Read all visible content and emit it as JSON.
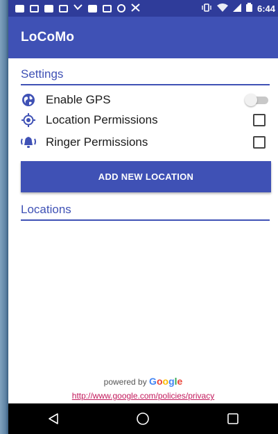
{
  "status_bar": {
    "time": "6:44",
    "notification_icons": [
      "message-icon",
      "list-icon",
      "card-icon",
      "gmail-icon",
      "missed-call-icon",
      "image-icon",
      "gallery-icon",
      "whatsapp-icon",
      "tools-icon"
    ],
    "system_icons": [
      "vibrate-icon",
      "wifi-icon",
      "signal-icon",
      "battery-icon"
    ]
  },
  "app_bar": {
    "title": "LoCoMo",
    "color": "#3f51b5"
  },
  "settings": {
    "header": "Settings",
    "items": [
      {
        "label": "Enable GPS",
        "icon": "globe-icon",
        "control": "toggle",
        "value": false
      },
      {
        "label": "Location Permissions",
        "icon": "location-target-icon",
        "control": "checkbox",
        "value": false
      },
      {
        "label": "Ringer Permissions",
        "icon": "ringer-icon",
        "control": "checkbox",
        "value": false
      }
    ]
  },
  "add_button": {
    "label": "ADD NEW LOCATION"
  },
  "locations": {
    "header": "Locations"
  },
  "footer": {
    "powered_prefix": "powered by ",
    "google_letters": [
      "G",
      "o",
      "o",
      "g",
      "l",
      "e"
    ],
    "privacy_link": "http://www.google.com/policies/privacy",
    "link_color": "#c2185b"
  },
  "nav_bar": {
    "buttons": [
      "back-icon",
      "home-icon",
      "recents-icon"
    ]
  }
}
